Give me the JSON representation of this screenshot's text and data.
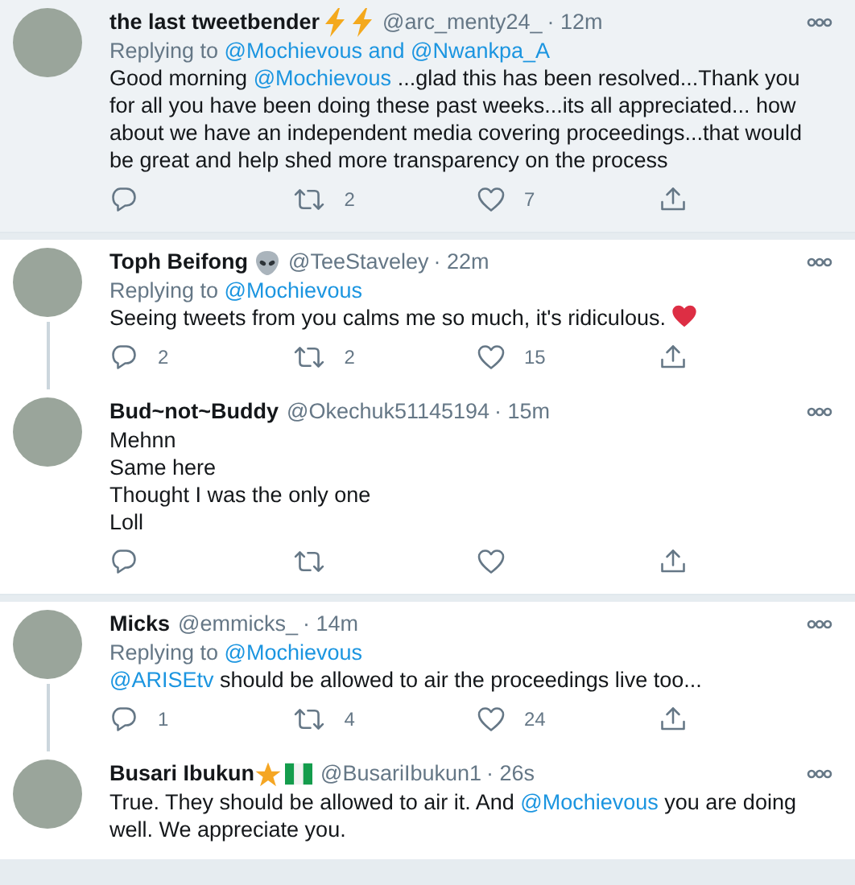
{
  "tweets": [
    {
      "name": "the last tweetbender",
      "badges": [
        {
          "kind": "lightning"
        },
        {
          "kind": "lightning"
        }
      ],
      "handle": "@arc_menty24_",
      "time": "· 12m",
      "highlighted": true,
      "thread_down": false,
      "replying": [
        {
          "kind": "text",
          "text": "Replying to "
        },
        {
          "kind": "mention",
          "text": "@Mochievous and @Nwankpa_A"
        }
      ],
      "body": [
        [
          {
            "kind": "text",
            "text": "Good morning "
          },
          {
            "kind": "mention",
            "text": "@Mochievous"
          },
          {
            "kind": "text",
            "text": " ...glad this has been resolved...Thank you for all you have been doing these past weeks...its all appreciated... how about we have an independent media covering proceedings...that would be great and help shed more transparency on the process"
          }
        ]
      ],
      "actions": true,
      "stats": {
        "retweet": "2",
        "like": "7"
      }
    },
    {
      "name": "Toph Beifong",
      "badges": [
        {
          "kind": "alien"
        }
      ],
      "handle": "@TeeStaveley",
      "time": "· 22m",
      "highlighted": false,
      "thread_down": true,
      "replying": [
        {
          "kind": "text",
          "text": "Replying to "
        },
        {
          "kind": "mention",
          "text": "@Mochievous"
        }
      ],
      "body": [
        [
          {
            "kind": "text",
            "text": "Seeing tweets from you calms me so much, it's ridiculous. "
          },
          {
            "kind": "heart"
          }
        ]
      ],
      "actions": true,
      "stats": {
        "reply": "2",
        "retweet": "2",
        "like": "15"
      }
    },
    {
      "name": "Bud~not~Buddy",
      "handle": "@Okechuk51145194",
      "time": "· 15m",
      "highlighted": false,
      "thread_down": false,
      "body": [
        [
          {
            "kind": "text",
            "text": "Mehnn"
          }
        ],
        [
          {
            "kind": "text",
            "text": "Same here"
          }
        ],
        [
          {
            "kind": "text",
            "text": "Thought I was the only one"
          }
        ],
        [
          {
            "kind": "text",
            "text": "Loll"
          }
        ]
      ],
      "actions": true
    },
    {
      "name": "Micks",
      "handle": "@emmicks_",
      "time": "· 14m",
      "highlighted": false,
      "thread_down": true,
      "replying": [
        {
          "kind": "text",
          "text": "Replying to "
        },
        {
          "kind": "mention",
          "text": "@Mochievous"
        }
      ],
      "body": [
        [
          {
            "kind": "mention",
            "text": "@ARISEtv"
          },
          {
            "kind": "text",
            "text": " should be allowed to air the proceedings live too..."
          }
        ]
      ],
      "actions": true,
      "stats": {
        "reply": "1",
        "retweet": "4",
        "like": "24"
      }
    },
    {
      "name": "Busari Ibukun",
      "badges": [
        {
          "kind": "star"
        },
        {
          "kind": "flag"
        }
      ],
      "handle": "@BusariIbukun1",
      "time": "· 26s",
      "highlighted": false,
      "thread_down": false,
      "actions": false,
      "body": [
        [
          {
            "kind": "text",
            "text": "True. They should be allowed to air it. And "
          },
          {
            "kind": "mention",
            "text": "@Mochievous"
          },
          {
            "kind": "text",
            "text": " you are doing well. We appreciate you."
          }
        ]
      ]
    }
  ]
}
